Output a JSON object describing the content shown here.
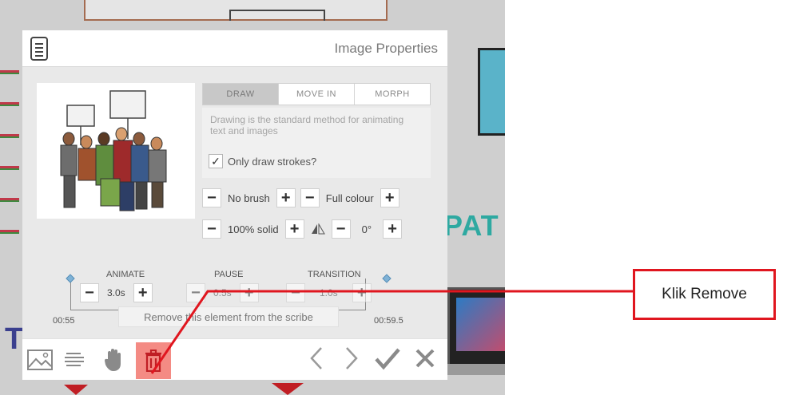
{
  "dialog": {
    "title": "Image Properties",
    "tabs": [
      "DRAW",
      "MOVE IN",
      "MORPH"
    ],
    "active_tab": "DRAW",
    "draw_description": "Drawing is the standard method for animating text and images",
    "only_draw_strokes": {
      "label": "Only draw strokes?",
      "checked": true
    },
    "brush_label": "No brush",
    "colour_label": "Full colour",
    "opacity_label": "100% solid",
    "rotation_label": "0°",
    "timing": {
      "animate_label": "ANIMATE",
      "pause_label": "PAUSE",
      "transition_label": "TRANSITION",
      "animate_value": "3.0s",
      "pause_value": "0.5s",
      "transition_value": "1.0s",
      "start_time": "00:55",
      "end_time": "00:59.5"
    },
    "tooltip": "Remove this element from the scribe"
  },
  "annotation": {
    "callout_text": "Klik Remove",
    "color": "#e0161f"
  },
  "colors": {
    "trash_bg": "#f48b84",
    "trash_icon": "#c01e24",
    "active_tab": "#c8c8c8"
  },
  "icons": {
    "header": "document-icon",
    "footer": [
      "image-icon",
      "text-lines-icon",
      "hand-icon",
      "trash-icon",
      "chevron-left-icon",
      "chevron-right-icon",
      "checkmark-icon",
      "close-icon"
    ]
  }
}
